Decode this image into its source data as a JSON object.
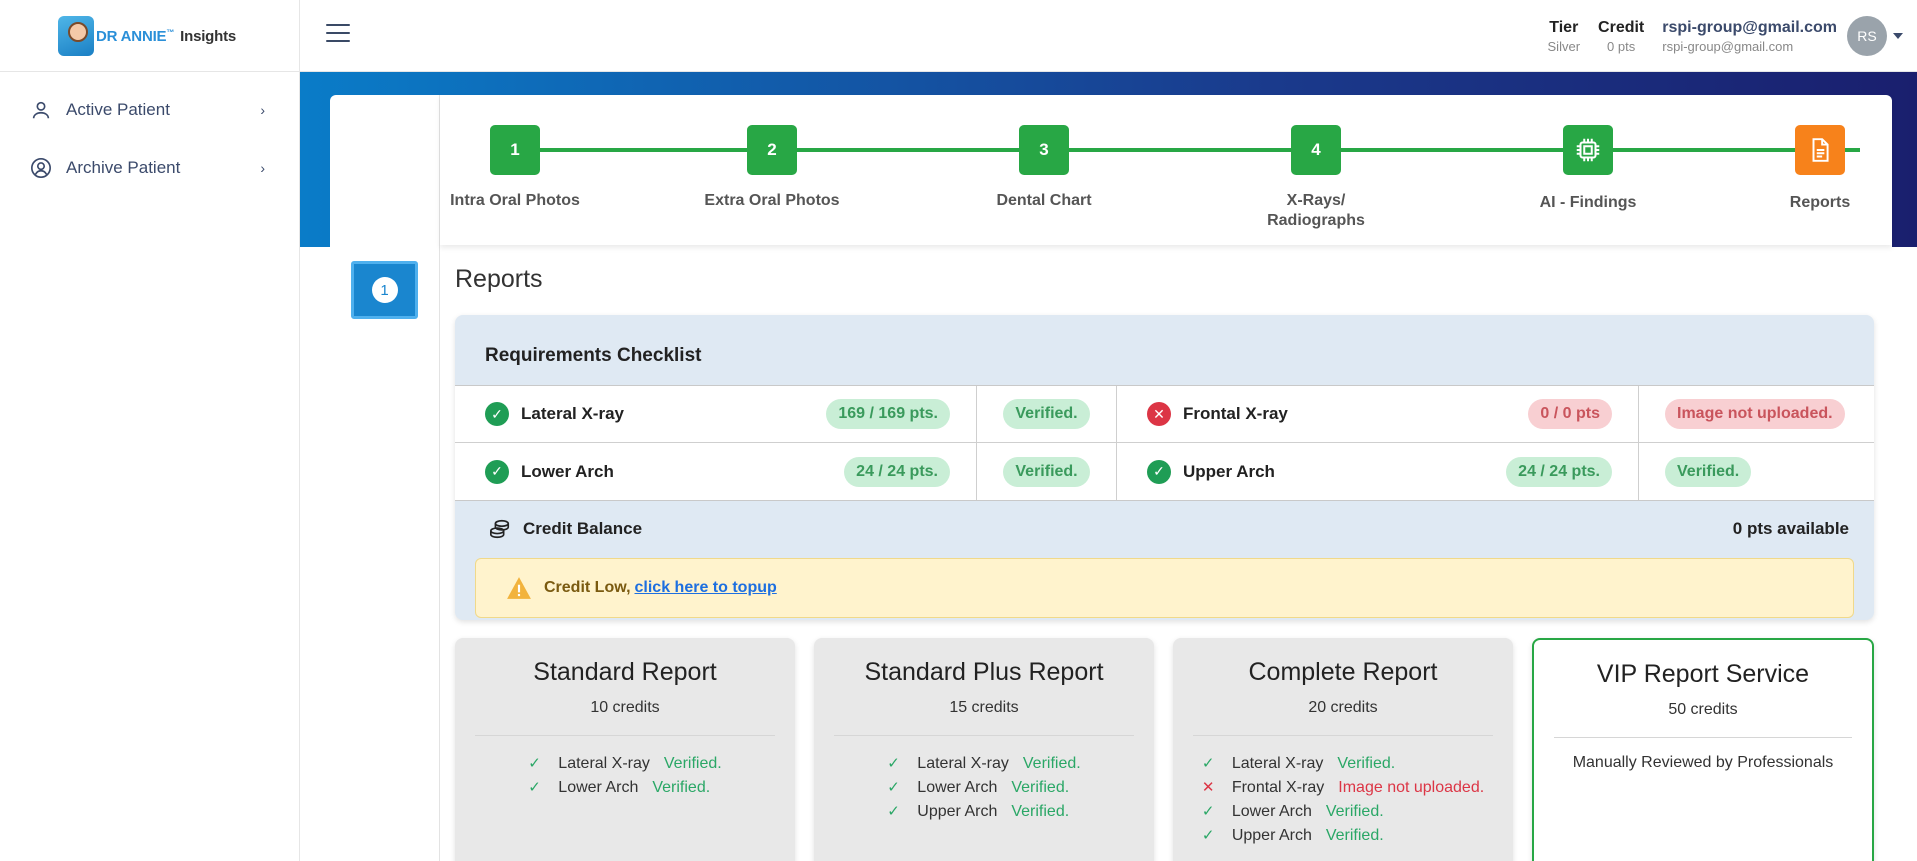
{
  "brand": {
    "name": "DR ANNIE",
    "tm": "™",
    "suffix": "Insights"
  },
  "header": {
    "tier_label": "Tier",
    "tier_value": "Silver",
    "credit_label": "Credit",
    "credit_value": "0 pts",
    "user_name": "rspi-group@gmail.com",
    "user_email": "rspi-group@gmail.com",
    "avatar_initials": "RS"
  },
  "sidebar": {
    "items": [
      {
        "label": "Active Patient",
        "icon": "user-icon"
      },
      {
        "label": "Archive Patient",
        "icon": "user-circle-icon"
      }
    ]
  },
  "stepper": {
    "steps": [
      {
        "number": "1",
        "label": "Intra Oral Photos"
      },
      {
        "number": "2",
        "label": "Extra Oral Photos"
      },
      {
        "number": "3",
        "label": "Dental Chart"
      },
      {
        "number": "4",
        "label": "X-Rays/\nRadiographs"
      },
      {
        "number": "",
        "label": "AI - Findings",
        "icon": "chip-icon"
      },
      {
        "number": "",
        "label": "Reports",
        "icon": "document-icon",
        "color": "#f7821b"
      }
    ],
    "line_color": "#28a745"
  },
  "side_step": {
    "number": "1"
  },
  "page_title": "Reports",
  "checklist": {
    "title": "Requirements Checklist",
    "rows": [
      [
        {
          "name": "Lateral X-ray",
          "status": "ok",
          "pts": "169 / 169 pts.",
          "badge": "Verified."
        },
        {
          "name": "Frontal X-ray",
          "status": "fail",
          "pts": "0 / 0 pts",
          "badge": "Image not uploaded."
        }
      ],
      [
        {
          "name": "Lower Arch",
          "status": "ok",
          "pts": "24 / 24 pts.",
          "badge": "Verified."
        },
        {
          "name": "Upper Arch",
          "status": "ok",
          "pts": "24 / 24 pts.",
          "badge": "Verified."
        }
      ]
    ],
    "credit_balance_label": "Credit Balance",
    "credit_balance_value": "0 pts available",
    "alert_text": "Credit Low,",
    "alert_link": "click here to topup"
  },
  "reports": [
    {
      "title": "Standard Report",
      "credits": "10 credits",
      "items": [
        {
          "mark": "ok",
          "name": "Lateral X-ray",
          "status": "Verified."
        },
        {
          "mark": "ok",
          "name": "Lower Arch",
          "status": "Verified."
        }
      ]
    },
    {
      "title": "Standard Plus Report",
      "credits": "15 credits",
      "items": [
        {
          "mark": "ok",
          "name": "Lateral X-ray",
          "status": "Verified."
        },
        {
          "mark": "ok",
          "name": "Lower Arch",
          "status": "Verified."
        },
        {
          "mark": "ok",
          "name": "Upper Arch",
          "status": "Verified."
        }
      ]
    },
    {
      "title": "Complete Report",
      "credits": "20 credits",
      "items": [
        {
          "mark": "ok",
          "name": "Lateral X-ray",
          "status": "Verified."
        },
        {
          "mark": "no",
          "name": "Frontal X-ray",
          "status": "Image not uploaded."
        },
        {
          "mark": "ok",
          "name": "Lower Arch",
          "status": "Verified."
        },
        {
          "mark": "ok",
          "name": "Upper Arch",
          "status": "Verified."
        }
      ]
    },
    {
      "title": "VIP Report Service",
      "credits": "50 credits",
      "description": "Manually Reviewed by Professionals"
    }
  ]
}
